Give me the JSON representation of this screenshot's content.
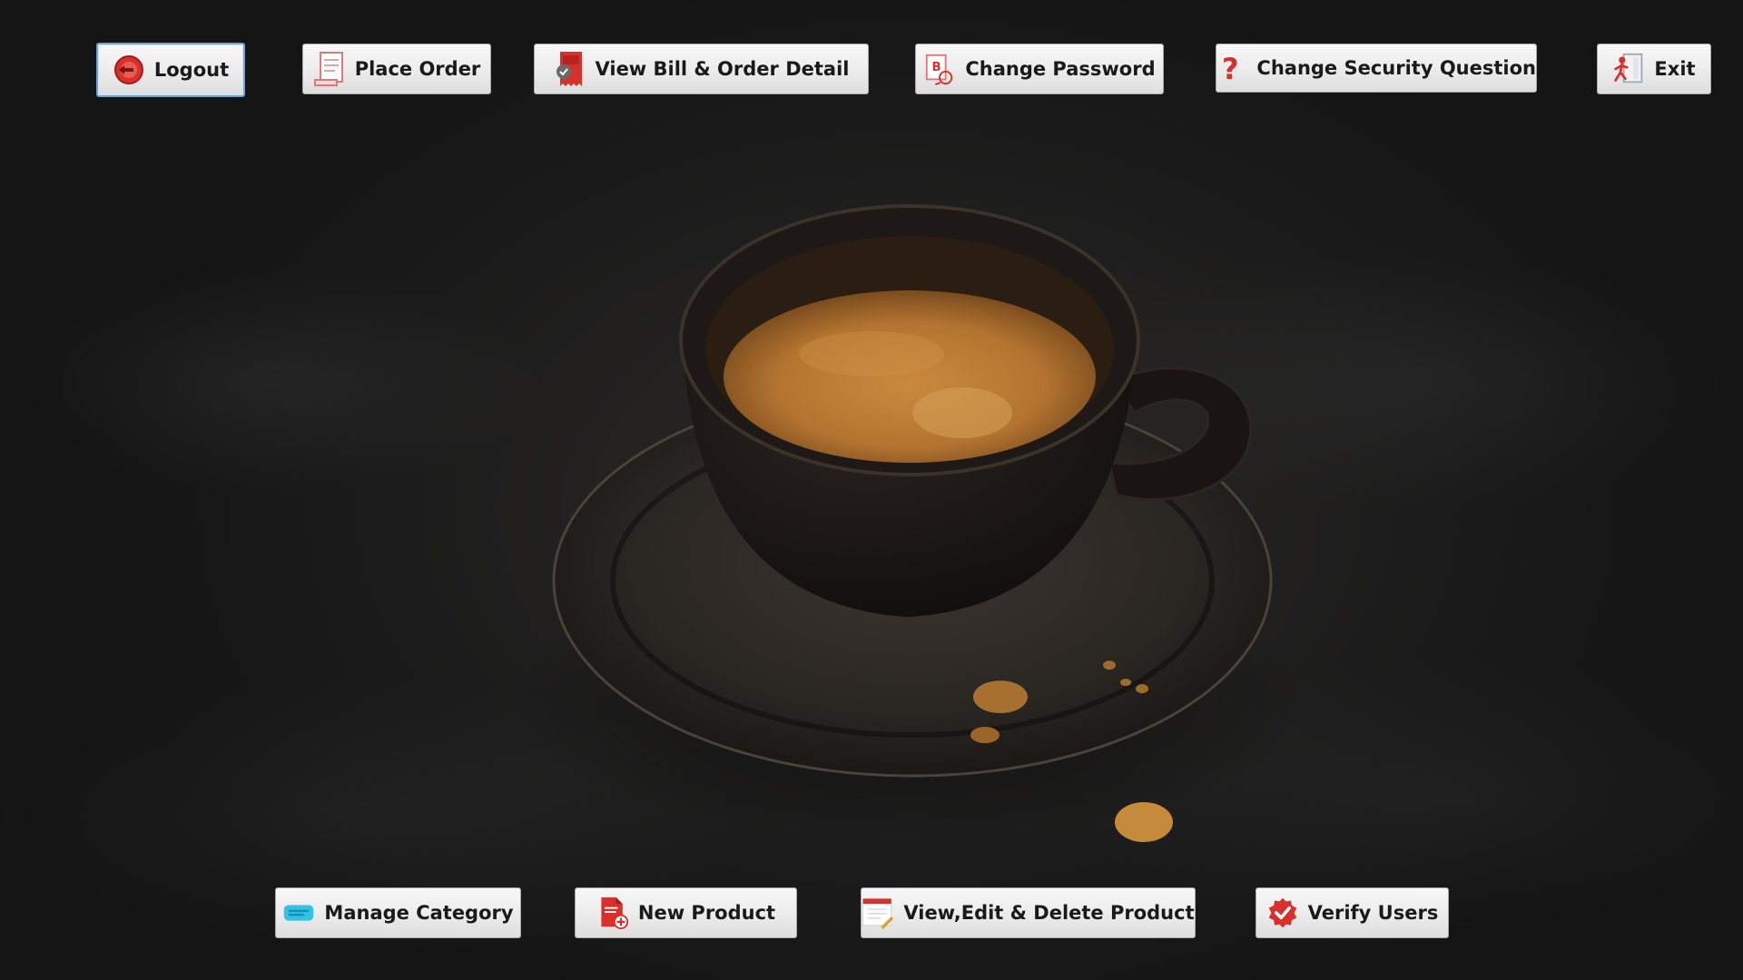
{
  "top_toolbar": {
    "logout": {
      "label": "Logout",
      "icon": "logout-icon"
    },
    "place_order": {
      "label": "Place Order",
      "icon": "receipt-icon"
    },
    "view_bill": {
      "label": "View Bill & Order Detail",
      "icon": "bill-icon"
    },
    "change_password": {
      "label": "Change Password",
      "icon": "password-icon"
    },
    "change_security_question": {
      "label": "Change Security Question",
      "icon": "question-mark-icon"
    },
    "exit": {
      "label": "Exit",
      "icon": "exit-door-icon"
    }
  },
  "bottom_toolbar": {
    "manage_category": {
      "label": "Manage Category",
      "icon": "category-icon"
    },
    "new_product": {
      "label": "New Product",
      "icon": "new-document-icon"
    },
    "view_edit_delete_product": {
      "label": "View,Edit & Delete Product",
      "icon": "edit-document-icon"
    },
    "verify_users": {
      "label": "Verify Users",
      "icon": "verified-badge-icon"
    }
  },
  "colors": {
    "background": "#1b1b1b",
    "button_face": "#eeeeee",
    "focus_border": "#6aa2d9",
    "icon_red": "#d9302c",
    "coffee": "#b87a32"
  }
}
